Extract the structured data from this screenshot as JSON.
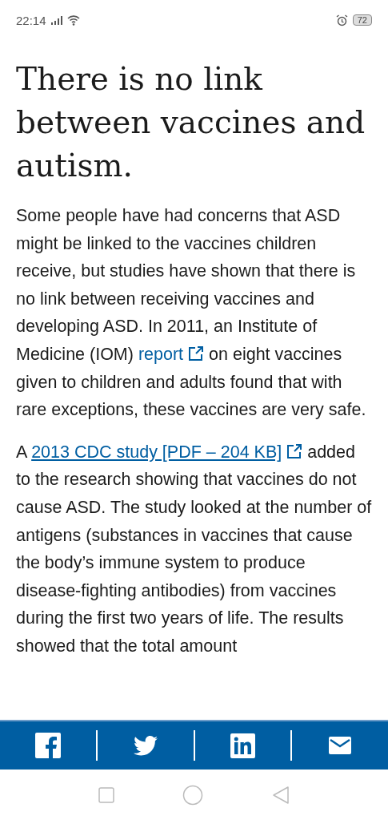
{
  "status_bar": {
    "time": "22:14",
    "battery": "72"
  },
  "heading": "There is no link between vaccines and autism.",
  "paragraphs": [
    {
      "before": "Some people have had concerns that ASD might be linked to the vaccines children receive, but studies have shown that there is no link between receiving vaccines and developing ASD. In 2011, an Institute of Medicine (IOM) ",
      "link": "report",
      "underlined": false,
      "after": " on eight vaccines given to children and adults found that with rare exceptions, these vaccines are very safe."
    },
    {
      "before": "A ",
      "link": "2013 CDC study [PDF – 204 KB]",
      "underlined": true,
      "after": " added to the research showing that vaccines do not cause ASD. The study looked at the number of antigens (substances in vaccines that cause the body’s immune system to produce disease-fighting antibodies) from vaccines during the first two years of life. The results showed that the total amount"
    }
  ],
  "share_bar": [
    {
      "kind": "facebook"
    },
    {
      "kind": "twitter"
    },
    {
      "kind": "linkedin"
    },
    {
      "kind": "email"
    }
  ]
}
